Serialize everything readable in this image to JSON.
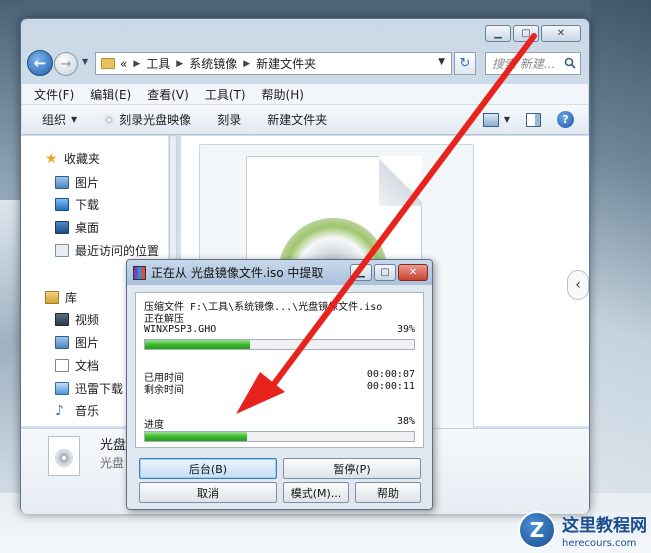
{
  "explorer": {
    "breadcrumb": {
      "prefix": "«",
      "items": [
        "工具",
        "系统镜像",
        "新建文件夹"
      ]
    },
    "search_placeholder": "搜索 新建...",
    "menu": [
      "文件(F)",
      "编辑(E)",
      "查看(V)",
      "工具(T)",
      "帮助(H)"
    ],
    "toolbar": {
      "organize": "组织",
      "burn_image": "刻录光盘映像",
      "burn": "刻录",
      "new_folder": "新建文件夹"
    },
    "nav": {
      "favorites": {
        "label": "收藏夹",
        "items": [
          "图片",
          "下载",
          "桌面",
          "最近访问的位置"
        ]
      },
      "libraries": {
        "label": "库",
        "items": [
          "视频",
          "图片",
          "文档",
          "迅雷下载",
          "音乐"
        ]
      }
    },
    "details": {
      "name": "光盘",
      "type": "光盘"
    }
  },
  "dialog": {
    "title": "正在从 光盘镜像文件.iso 中提取",
    "archive_line": "压缩文件 F:\\工具\\系统镜像...\\光盘镜像文件.iso",
    "status": "正在解压",
    "current_file": "WINXPSP3.GHO",
    "file_percent": "39%",
    "file_progress": 0.39,
    "elapsed_label": "已用时间",
    "elapsed": "00:00:07",
    "remaining_label": "剩余时间",
    "remaining": "00:00:11",
    "total_label": "进度",
    "total_percent": "38%",
    "total_progress": 0.38,
    "buttons": {
      "background": "后台(B)",
      "pause": "暂停(P)",
      "cancel": "取消",
      "mode": "模式(M)...",
      "help": "帮助"
    }
  },
  "watermark": {
    "title": "这里教程网",
    "url": "herecours.com",
    "badge": "Z"
  },
  "colors": {
    "arrow": "#e8231d",
    "progress_green": "#39b52a"
  }
}
